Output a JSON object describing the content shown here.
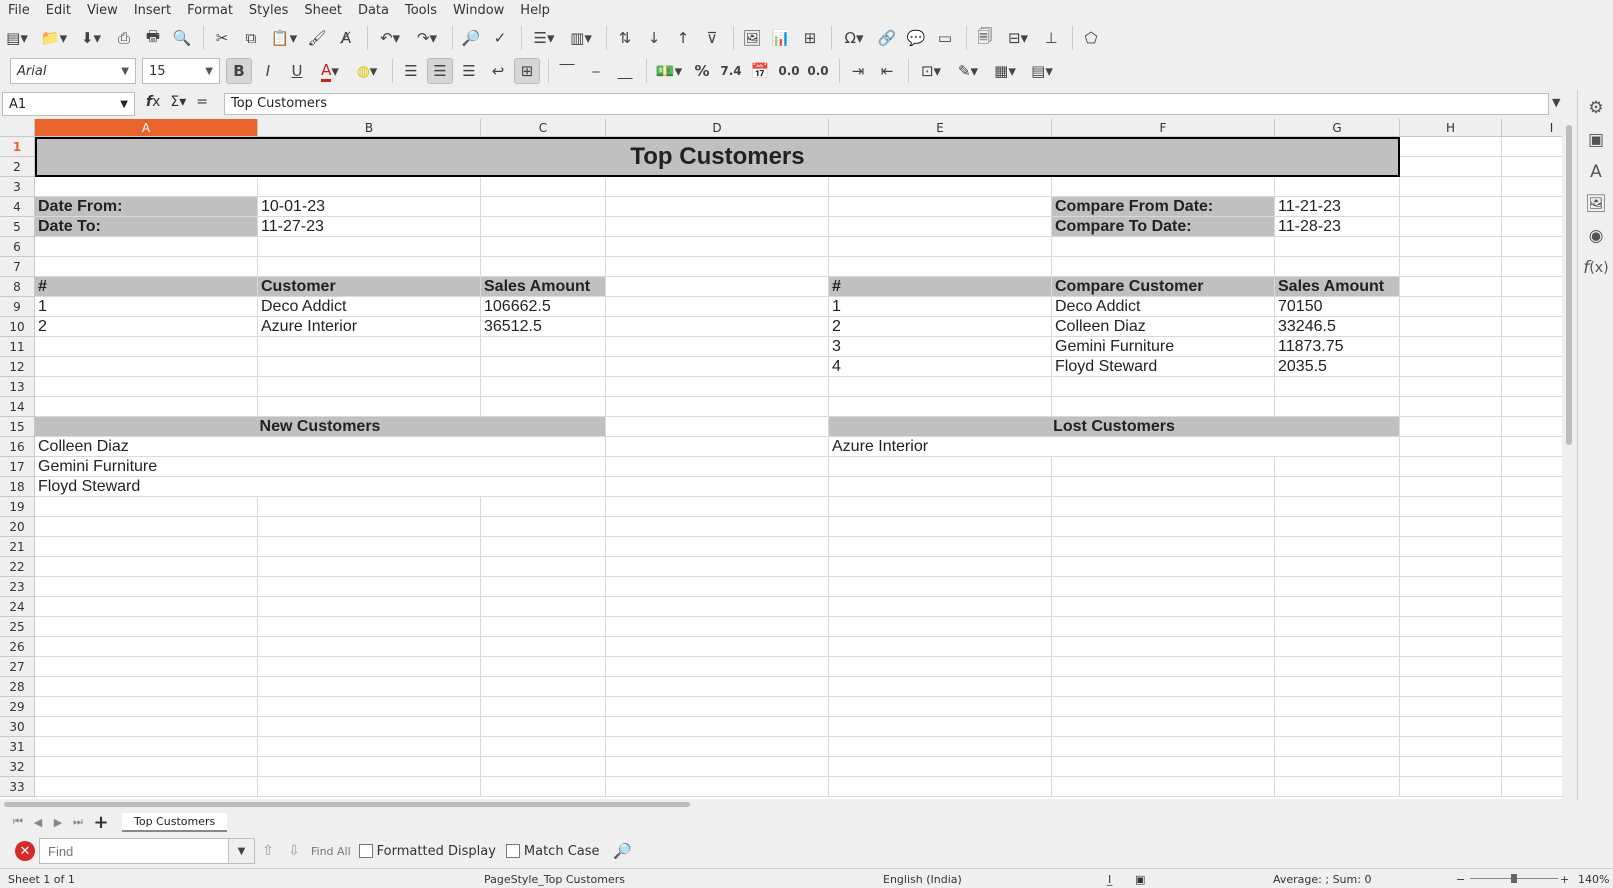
{
  "menu": [
    "File",
    "Edit",
    "View",
    "Insert",
    "Format",
    "Styles",
    "Sheet",
    "Data",
    "Tools",
    "Window",
    "Help"
  ],
  "formatting": {
    "font_name": "Arial",
    "font_size": "15"
  },
  "toolbar_glyphs": {
    "bold": "B",
    "italic": "I",
    "underline": "U",
    "percent": "%",
    "number": "7.4",
    "add_decimal": "0.0",
    "del_decimal": "0.0"
  },
  "formula_bar": {
    "cell_ref": "A1",
    "content": "Top Customers"
  },
  "columns": [
    "A",
    "B",
    "C",
    "D",
    "E",
    "F",
    "G",
    "H",
    "I"
  ],
  "selected_cell": {
    "column": "A",
    "row": 1
  },
  "sheet": {
    "title": "Top Customers",
    "date_from_label": "Date From:",
    "date_from": "10-01-23",
    "date_to_label": "Date To:",
    "date_to": "11-27-23",
    "compare_from_label": "Compare From Date:",
    "compare_from": "11-21-23",
    "compare_to_label": "Compare To Date:",
    "compare_to": "11-28-23",
    "left_table": {
      "headers": [
        "#",
        "Customer",
        "Sales Amount"
      ],
      "rows": [
        [
          "1",
          "Deco Addict",
          "106662.5"
        ],
        [
          "2",
          "Azure Interior",
          "36512.5"
        ]
      ]
    },
    "right_table": {
      "headers": [
        "#",
        "Compare Customer",
        "Sales Amount"
      ],
      "rows": [
        [
          "1",
          "Deco Addict",
          "70150"
        ],
        [
          "2",
          "Colleen Diaz",
          "33246.5"
        ],
        [
          "3",
          "Gemini Furniture",
          "11873.75"
        ],
        [
          "4",
          "Floyd Steward",
          "2035.5"
        ]
      ]
    },
    "new_customers_title": "New Customers",
    "new_customers": [
      "Colleen Diaz",
      "Gemini Furniture",
      "Floyd Steward"
    ],
    "lost_customers_title": "Lost Customers",
    "lost_customers": [
      "Azure Interior"
    ]
  },
  "tabs": [
    "Top Customers"
  ],
  "findbar": {
    "placeholder": "Find",
    "find_all": "Find All",
    "formatted_display": "Formatted Display",
    "match_case": "Match Case"
  },
  "status": {
    "sheet": "Sheet 1 of 1",
    "page_style": "PageStyle_Top Customers",
    "language": "English (India)",
    "summary": "Average: ; Sum: 0",
    "zoom": "140%"
  }
}
